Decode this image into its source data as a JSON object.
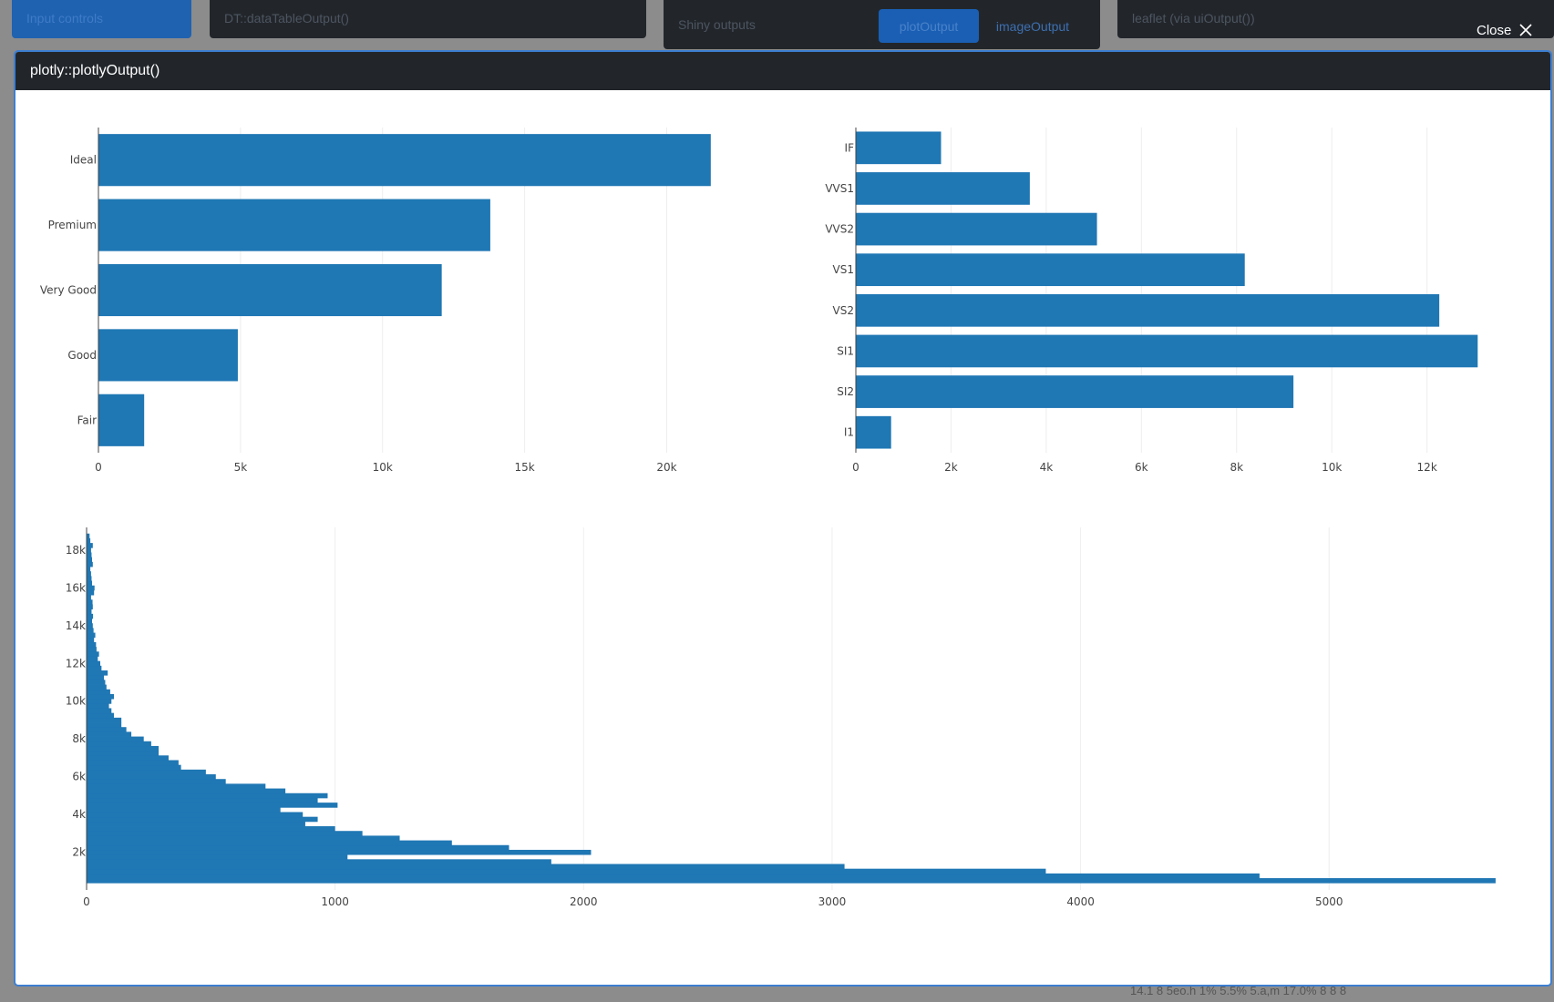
{
  "background": {
    "card1_label": "Input controls",
    "card2_label": "DT::dataTableOutput()",
    "card3_label": "Shiny outputs",
    "card3_btn1": "plotOutput",
    "card3_btn2": "imageOutput",
    "card4_label": "leaflet (via uiOutput())",
    "bottom_text": "14.1   8   5eo.h   1%   5.5%   5.a,m   17.0%   8   8   8"
  },
  "close": {
    "label": "Close",
    "icon": "close-icon"
  },
  "modal": {
    "title": "plotly::plotlyOutput()"
  },
  "colors": {
    "bar": "#1f77b4",
    "grid": "#eeeeee",
    "axis": "#444444"
  },
  "chart_data": [
    {
      "type": "bar",
      "orientation": "horizontal",
      "categories": [
        "Fair",
        "Good",
        "Very Good",
        "Premium",
        "Ideal"
      ],
      "values": [
        1610,
        4906,
        12082,
        13791,
        21551
      ],
      "xlim": [
        0,
        23000
      ],
      "xticks": [
        0,
        5000,
        10000,
        15000,
        20000
      ],
      "xtick_labels": [
        "0",
        "5k",
        "10k",
        "15k",
        "20k"
      ],
      "grid": true
    },
    {
      "type": "bar",
      "orientation": "horizontal",
      "categories": [
        "I1",
        "SI2",
        "SI1",
        "VS2",
        "VS1",
        "VVS2",
        "VVS1",
        "IF"
      ],
      "values": [
        741,
        9194,
        13065,
        12258,
        8171,
        5066,
        3655,
        1790
      ],
      "xlim": [
        0,
        13500
      ],
      "xticks": [
        0,
        2000,
        4000,
        6000,
        8000,
        10000,
        12000
      ],
      "xtick_labels": [
        "0",
        "2k",
        "4k",
        "6k",
        "8k",
        "10k",
        "12k"
      ],
      "grid": true
    },
    {
      "type": "bar",
      "orientation": "horizontal",
      "description": "histogram of price",
      "y": [
        500,
        750,
        1000,
        1250,
        1500,
        1750,
        2000,
        2250,
        2500,
        2750,
        3000,
        3250,
        3500,
        3750,
        4000,
        4250,
        4500,
        4750,
        5000,
        5250,
        5500,
        5750,
        6000,
        6250,
        6500,
        6750,
        7000,
        7250,
        7500,
        7750,
        8000,
        8250,
        8500,
        8750,
        9000,
        9250,
        9500,
        9750,
        10000,
        10250,
        10500,
        10750,
        11000,
        11250,
        11500,
        11750,
        12000,
        12250,
        12500,
        12750,
        13000,
        13250,
        13500,
        13750,
        14000,
        14250,
        14500,
        14750,
        15000,
        15250,
        15500,
        15750,
        16000,
        16250,
        16500,
        16750,
        17000,
        17250,
        17500,
        17750,
        18000,
        18250,
        18500,
        18750
      ],
      "values": [
        5670,
        4720,
        3860,
        3050,
        1870,
        1050,
        2030,
        1700,
        1470,
        1260,
        1110,
        1000,
        880,
        930,
        870,
        780,
        1010,
        930,
        970,
        800,
        720,
        560,
        520,
        480,
        380,
        370,
        330,
        290,
        290,
        260,
        230,
        180,
        160,
        140,
        140,
        110,
        100,
        90,
        100,
        110,
        95,
        80,
        75,
        70,
        85,
        60,
        55,
        45,
        50,
        40,
        38,
        30,
        35,
        28,
        25,
        22,
        26,
        20,
        25,
        24,
        18,
        30,
        32,
        22,
        20,
        18,
        15,
        25,
        22,
        20,
        18,
        25,
        15,
        12
      ],
      "ylim": [
        0,
        19200
      ],
      "yticks": [
        2000,
        4000,
        6000,
        8000,
        10000,
        12000,
        14000,
        16000,
        18000
      ],
      "ytick_labels": [
        "2k",
        "4k",
        "6k",
        "8k",
        "10k",
        "12k",
        "14k",
        "16k",
        "18k"
      ],
      "xlim": [
        0,
        5850
      ],
      "xticks": [
        0,
        1000,
        2000,
        3000,
        4000,
        5000
      ],
      "xtick_labels": [
        "0",
        "1000",
        "2000",
        "3000",
        "4000",
        "5000"
      ],
      "grid": true
    }
  ]
}
